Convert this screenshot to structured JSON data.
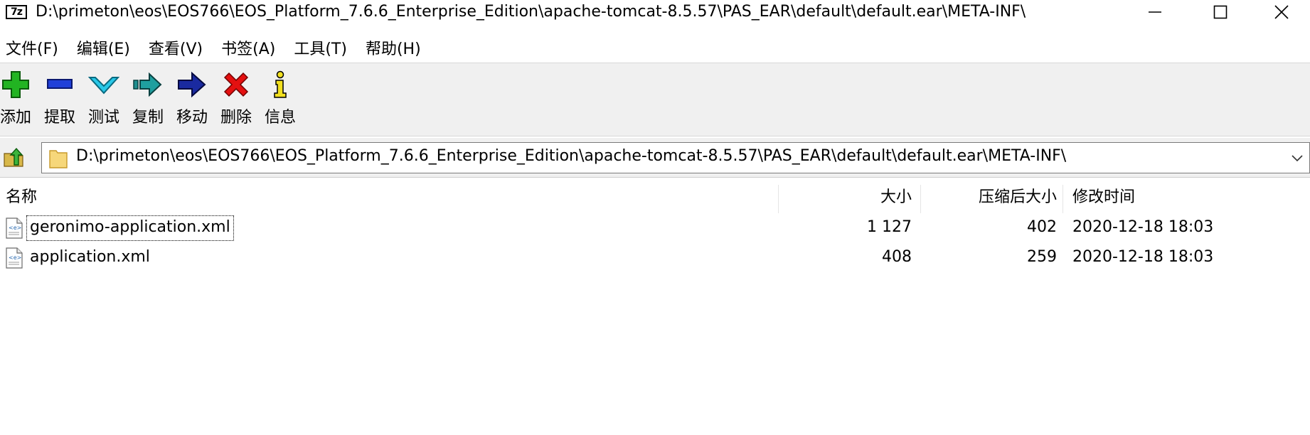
{
  "window": {
    "icon_text": "7z",
    "title": "D:\\primeton\\eos\\EOS766\\EOS_Platform_7.6.6_Enterprise_Edition\\apache-tomcat-8.5.57\\PAS_EAR\\default\\default.ear\\META-INF\\",
    "controls": [
      "minimize-icon",
      "maximize-icon",
      "close-icon"
    ]
  },
  "menu": {
    "items": [
      {
        "label": "文件(F)"
      },
      {
        "label": "编辑(E)"
      },
      {
        "label": "查看(V)"
      },
      {
        "label": "书签(A)"
      },
      {
        "label": "工具(T)"
      },
      {
        "label": "帮助(H)"
      }
    ]
  },
  "toolbar": {
    "buttons": [
      {
        "label": "添加",
        "icon": "add-plus-icon",
        "color": "#20b020"
      },
      {
        "label": "提取",
        "icon": "extract-minus-icon",
        "color": "#1f3fd0"
      },
      {
        "label": "测试",
        "icon": "test-check-icon",
        "color": "#20c0e0"
      },
      {
        "label": "复制",
        "icon": "copy-arrow-icon",
        "color": "#1f8f8f"
      },
      {
        "label": "移动",
        "icon": "move-arrow-icon",
        "color": "#1a2a9a"
      },
      {
        "label": "删除",
        "icon": "delete-x-icon",
        "color": "#e01010"
      },
      {
        "label": "信息",
        "icon": "info-icon",
        "color": "#f0e020"
      }
    ]
  },
  "address": {
    "path": "D:\\primeton\\eos\\EOS766\\EOS_Platform_7.6.6_Enterprise_Edition\\apache-tomcat-8.5.57\\PAS_EAR\\default\\default.ear\\META-INF\\"
  },
  "list": {
    "columns": {
      "name": "名称",
      "size": "大小",
      "packed": "压缩后大小",
      "mtime": "修改时间"
    },
    "rows": [
      {
        "name": "geronimo-application.xml",
        "size": "1 127",
        "packed": "402",
        "mtime": "2020-12-18 18:03",
        "focused": true
      },
      {
        "name": "application.xml",
        "size": "408",
        "packed": "259",
        "mtime": "2020-12-18 18:03",
        "focused": false
      }
    ]
  }
}
